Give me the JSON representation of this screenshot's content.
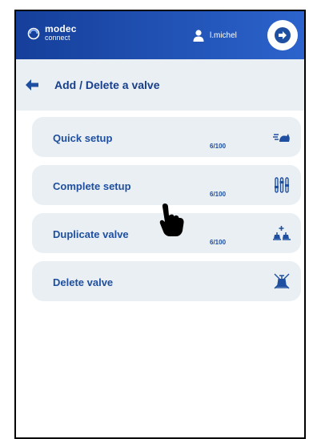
{
  "header": {
    "logo_brand": "modec",
    "logo_sub": "connect",
    "username": "l.michel"
  },
  "page": {
    "title": "Add / Delete a valve"
  },
  "menu": [
    {
      "label": "Quick setup",
      "count": "6/100",
      "icon": "quick-setup-icon"
    },
    {
      "label": "Complete setup",
      "count": "6/100",
      "icon": "sliders-icon"
    },
    {
      "label": "Duplicate valve",
      "count": "6/100",
      "icon": "duplicate-icon"
    },
    {
      "label": "Delete valve",
      "count": "",
      "icon": "delete-valve-icon"
    }
  ],
  "colors": {
    "header_start": "#153f9a",
    "header_end": "#2c63cc",
    "accent_text": "#1f4fa0",
    "card_bg": "#e9eff3"
  }
}
